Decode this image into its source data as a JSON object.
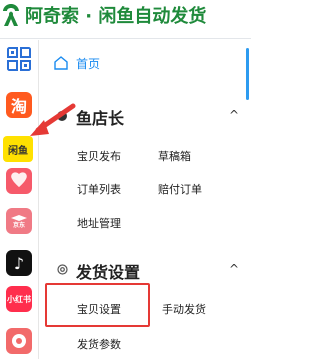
{
  "header": {
    "title": "阿奇索 · 闲鱼自动发货"
  },
  "platforms": [
    {
      "name": "grid",
      "label": ""
    },
    {
      "name": "taobao",
      "label": "淘"
    },
    {
      "name": "xianyu",
      "label": "闲鱼"
    },
    {
      "name": "pinduoduo",
      "label": ""
    },
    {
      "name": "jingdong",
      "label": "京东"
    },
    {
      "name": "douyin",
      "label": "♪"
    },
    {
      "name": "xiaohongshu",
      "label": "小红书"
    },
    {
      "name": "other",
      "label": ""
    }
  ],
  "menu": {
    "home": {
      "label": "首页",
      "icon": "home-icon"
    },
    "sections": [
      {
        "title": "鱼店长",
        "expanded": true,
        "items": [
          "宝贝发布",
          "草稿箱",
          "订单列表",
          "赔付订单",
          "地址管理"
        ]
      },
      {
        "title": "发货设置",
        "icon": "gear-icon",
        "expanded": true,
        "items": [
          "宝贝设置",
          "手动发货",
          "发货参数"
        ]
      }
    ]
  },
  "colors": {
    "brand": "#1f8a3b",
    "active": "#1a8bf0",
    "highlight": "#e53935"
  }
}
